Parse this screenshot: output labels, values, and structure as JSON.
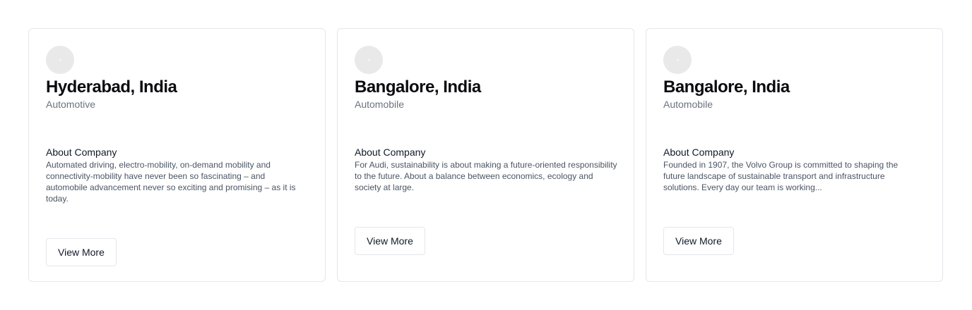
{
  "cards": [
    {
      "location": "Hyderabad, India",
      "industry": "Automotive",
      "about_title": "About Company",
      "about_text": "Automated driving, electro-mobility, on-demand mobility and connectivity-mobility have never been so fascinating – and automobile advancement never so exciting and promising – as it is today.",
      "button_label": "View More"
    },
    {
      "location": "Bangalore, India",
      "industry": "Automobile",
      "about_title": "About Company",
      "about_text": "For Audi, sustainability is about making a future-oriented responsibility to the future. About a balance between economics, ecology and society at large.",
      "button_label": "View More"
    },
    {
      "location": "Bangalore, India",
      "industry": "Automobile",
      "about_title": "About Company",
      "about_text": "Founded in 1907, the Volvo Group is committed to shaping the future landscape of sustainable transport and infrastructure solutions. Every day our team is working...",
      "button_label": "View More"
    }
  ]
}
